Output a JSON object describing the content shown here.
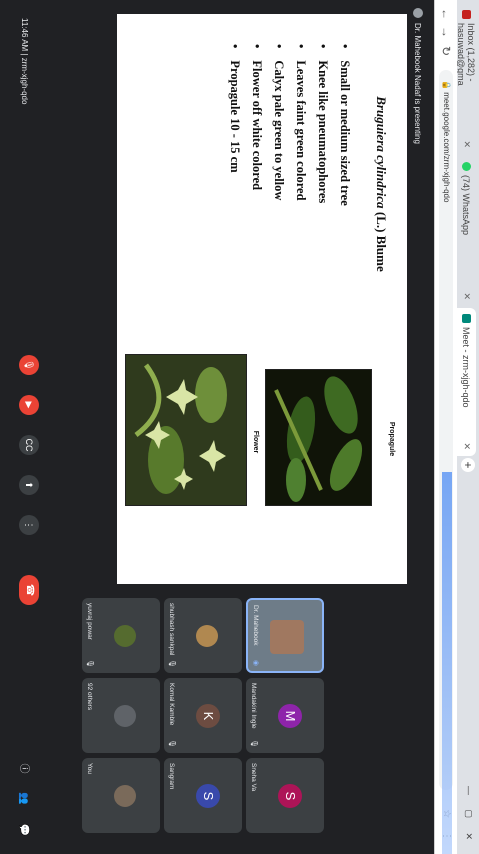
{
  "browser": {
    "tabs": [
      {
        "label": "Inbox (1,282) - hasuwad@gma",
        "color": "#c5221f"
      },
      {
        "label": "(74) WhatsApp",
        "color": "#25d366"
      },
      {
        "label": "Meet - zrm-xjgh-qdo",
        "color": "#00897b"
      }
    ],
    "url": "meet.google.com/zrm-xjgh-qdo"
  },
  "meet": {
    "presenter_label": "Dr. Mahebook Nadaf is presenting",
    "time": "11:46 AM",
    "meeting_code": "zrm-xjgh-qdo"
  },
  "slide": {
    "title_species": "Bruguiera cylindrica",
    "title_author": " (L.) Blume",
    "bullets": [
      "Small or medium sized tree",
      "Knee like pneumatophores",
      "Leaves faint green colored",
      "Calyx pale green to yellow",
      "Flower off white colored",
      "Propagule 10 - 15 cm"
    ],
    "caption_flower": "Flower",
    "caption_propagule": "Propagule"
  },
  "participants": [
    {
      "name": "Dr. Mahebook",
      "letter": "",
      "color": "#6e7c88"
    },
    {
      "name": "Mandakini Ingle",
      "letter": "M",
      "color": "#8e24aa"
    },
    {
      "name": "Sneha Va",
      "letter": "S",
      "color": "#ad1457"
    },
    {
      "name": "shubhash sankpal",
      "letter": "",
      "color": "#b08850"
    },
    {
      "name": "Komal Kamble",
      "letter": "K",
      "color": "#6d4c41"
    },
    {
      "name": "Sangram",
      "letter": "S",
      "color": "#3949ab"
    },
    {
      "name": "yuvraj powar",
      "letter": "",
      "color": "#556b2f"
    },
    {
      "name": "92 others",
      "letter": "",
      "color": "#5f6368"
    },
    {
      "name": "You",
      "letter": "",
      "color": "#7a6a5a"
    }
  ]
}
